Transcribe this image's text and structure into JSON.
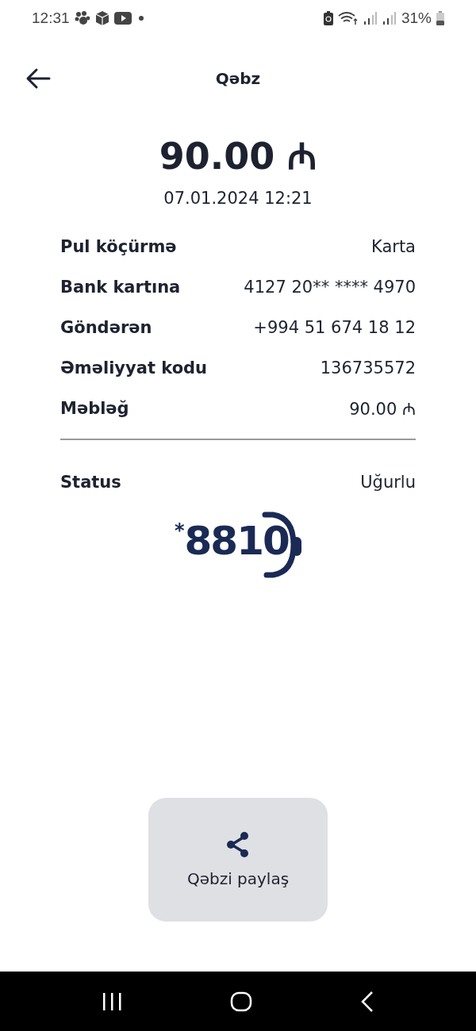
{
  "status_bar": {
    "time": "12:31",
    "battery": "31%"
  },
  "header": {
    "title": "Qəbz"
  },
  "amount": "90.00 ₼",
  "date": "07.01.2024 12:21",
  "details": [
    {
      "label": "Pul köçürmə",
      "value": "Karta"
    },
    {
      "label": "Bank kartına",
      "value": "4127 20** **** 4970"
    },
    {
      "label": "Göndərən",
      "value": "+994 51 674 18 12"
    },
    {
      "label": "Əməliyyat kodu",
      "value": "136735572"
    },
    {
      "label": "Məbləğ",
      "value": "90.00 ₼"
    }
  ],
  "status": {
    "label": "Status",
    "value": "Uğurlu"
  },
  "logo": {
    "text": "8810",
    "mark": "*"
  },
  "share_button": {
    "label": "Qəbzi paylaş"
  }
}
